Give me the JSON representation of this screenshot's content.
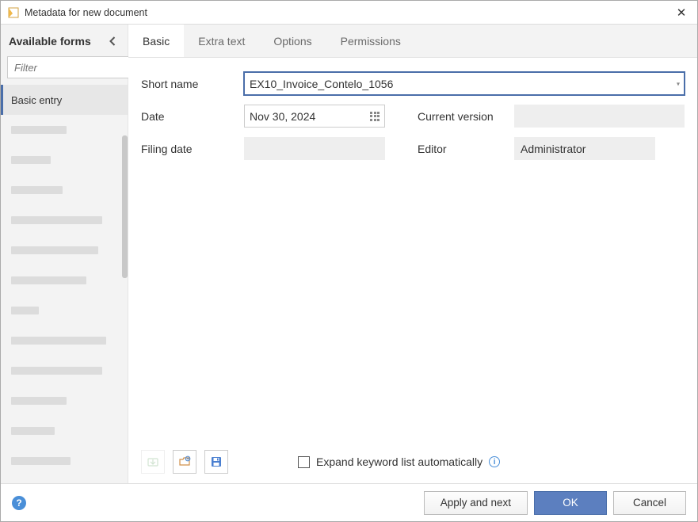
{
  "window": {
    "title": "Metadata for new document"
  },
  "sidebar": {
    "title": "Available forms",
    "filter_placeholder": "Filter",
    "selected_form": "Basic entry"
  },
  "tabs": [
    {
      "label": "Basic",
      "active": true
    },
    {
      "label": "Extra text",
      "active": false
    },
    {
      "label": "Options",
      "active": false
    },
    {
      "label": "Permissions",
      "active": false
    }
  ],
  "fields": {
    "short_name": {
      "label": "Short name",
      "value": "EX10_Invoice_Contelo_1056"
    },
    "date": {
      "label": "Date",
      "value": "Nov 30, 2024"
    },
    "current_version": {
      "label": "Current version",
      "value": ""
    },
    "filing_date": {
      "label": "Filing date",
      "value": ""
    },
    "editor": {
      "label": "Editor",
      "value": "Administrator"
    }
  },
  "bottom": {
    "expand_label": "Expand keyword list automatically",
    "expand_checked": false
  },
  "footer": {
    "apply_next": "Apply and next",
    "ok": "OK",
    "cancel": "Cancel"
  }
}
